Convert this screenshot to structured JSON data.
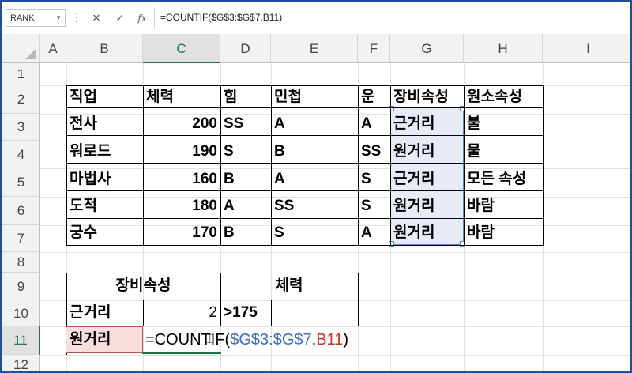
{
  "formula_bar": {
    "name_box": "RANK",
    "cancel_icon": "✕",
    "enter_icon": "✓",
    "fx_label": "fx",
    "formula": "=COUNTIF($G$3:$G$7,B11)"
  },
  "columns": [
    "A",
    "B",
    "C",
    "D",
    "E",
    "F",
    "G",
    "H",
    "I"
  ],
  "rows": [
    "1",
    "2",
    "3",
    "4",
    "5",
    "6",
    "7",
    "8",
    "9",
    "10",
    "11",
    "12"
  ],
  "table1": {
    "headers": [
      "직업",
      "체력",
      "힘",
      "민첩",
      "운",
      "장비속성",
      "원소속성"
    ],
    "rows": [
      [
        "전사",
        "200",
        "SS",
        "A",
        "A",
        "근거리",
        "불"
      ],
      [
        "워로드",
        "190",
        "S",
        "B",
        "SS",
        "원거리",
        "물"
      ],
      [
        "마법사",
        "160",
        "B",
        "A",
        "S",
        "근거리",
        "모든 속성"
      ],
      [
        "도적",
        "180",
        "A",
        "SS",
        "S",
        "원거리",
        "바람"
      ],
      [
        "궁수",
        "170",
        "B",
        "S",
        "A",
        "원거리",
        "바람"
      ]
    ]
  },
  "table2": {
    "header_equip": "장비속성",
    "header_hp": "체력",
    "row10": {
      "b": "근거리",
      "c": "2",
      "d": ">175"
    },
    "row11": {
      "b": "원거리"
    }
  },
  "editing": {
    "eq": "=COUNTIF(",
    "range": "$G$3:$G$7",
    "comma": ",",
    "ref": "B11",
    "close": ")"
  },
  "colors": {
    "accent": "#217346",
    "range_blue": "#3a6fc4",
    "ref_red": "#c0392b"
  }
}
